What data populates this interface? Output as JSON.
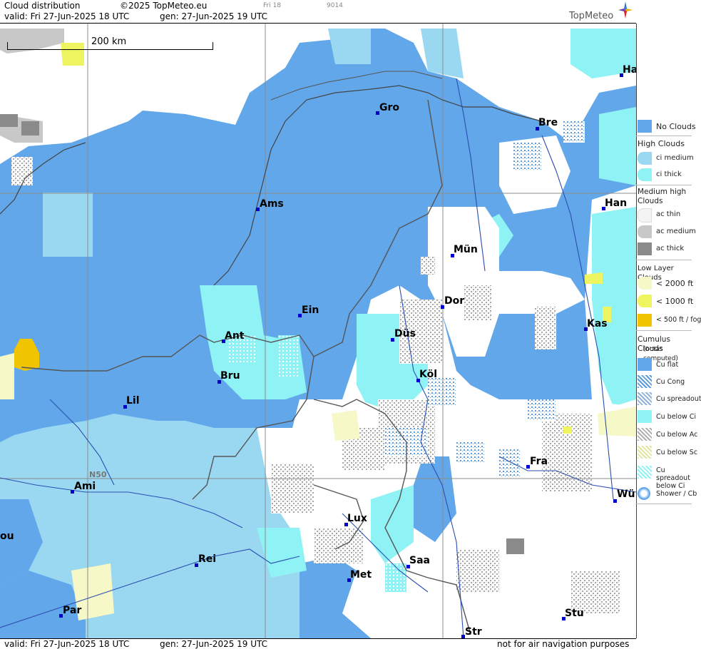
{
  "header": {
    "title": "Cloud distribution",
    "copyright": "©2025 TopMeteo.eu",
    "run_small": "Fri 18",
    "code_small": "9014",
    "valid": "valid:  Fri  27-Jun-2025  18 UTC",
    "generated": "gen: 27-Jun-2025 19 UTC",
    "logo_text": "TopMeteo"
  },
  "scale": {
    "label": "200 km"
  },
  "lat_label": "N50",
  "cities": [
    {
      "name": "Gro"
    },
    {
      "name": "Bre"
    },
    {
      "name": "Ha"
    },
    {
      "name": "Ams"
    },
    {
      "name": "Han"
    },
    {
      "name": "Mün"
    },
    {
      "name": "Ein"
    },
    {
      "name": "Dor"
    },
    {
      "name": "Kas"
    },
    {
      "name": "Ant"
    },
    {
      "name": "Düs"
    },
    {
      "name": "Bru"
    },
    {
      "name": "Köl"
    },
    {
      "name": "Lil"
    },
    {
      "name": "Ami"
    },
    {
      "name": "Fra"
    },
    {
      "name": "Wü"
    },
    {
      "name": "Lux"
    },
    {
      "name": "Rei"
    },
    {
      "name": "Saa"
    },
    {
      "name": "Met"
    },
    {
      "name": "Par"
    },
    {
      "name": "Stu"
    },
    {
      "name": "Str"
    },
    {
      "name": "ou"
    }
  ],
  "footer": {
    "valid": "valid:  Fri  27-Jun-2025  18 UTC",
    "generated": "gen: 27-Jun-2025 19 UTC",
    "disclaimer": "not for air navigation purposes"
  },
  "colors": {
    "no_clouds": "#62a7ea",
    "ci_medium": "#9ad8f2",
    "ci_thick": "#8ff2f5",
    "ac_medium": "#c8c8c8",
    "ac_thick": "#8a8a8a",
    "low_2000": "#f6f8c8",
    "low_1000": "#eef560",
    "low_500": "#f0c400"
  },
  "legend": {
    "no_clouds": "No Clouds",
    "high_title": "High Clouds",
    "ci_medium": "ci medium",
    "ci_thick": "ci thick",
    "medium_title": "Medium high Clouds",
    "ac_thin": "ac thin",
    "ac_medium": "ac medium",
    "ac_thick": "ac thick",
    "low_title": "Low Layer Clouds",
    "low_2000": "< 2000 ft",
    "low_1000": "< 1000 ft",
    "low_500": "< 500 ft / fog",
    "cumulus_title": "Cumulus Clouds",
    "cumulus_sub": "(octas computed)",
    "cu_flat": "Cu flat",
    "cu_cong": "Cu Cong",
    "cu_spreadout": "Cu spreadout",
    "cu_below_ci": "Cu below Ci",
    "cu_below_ac": "Cu below Ac",
    "cu_below_sc": "Cu below Sc",
    "cu_spreadout_below_ci": "Cu spreadout below Ci",
    "shower": "Shower / Cb"
  }
}
